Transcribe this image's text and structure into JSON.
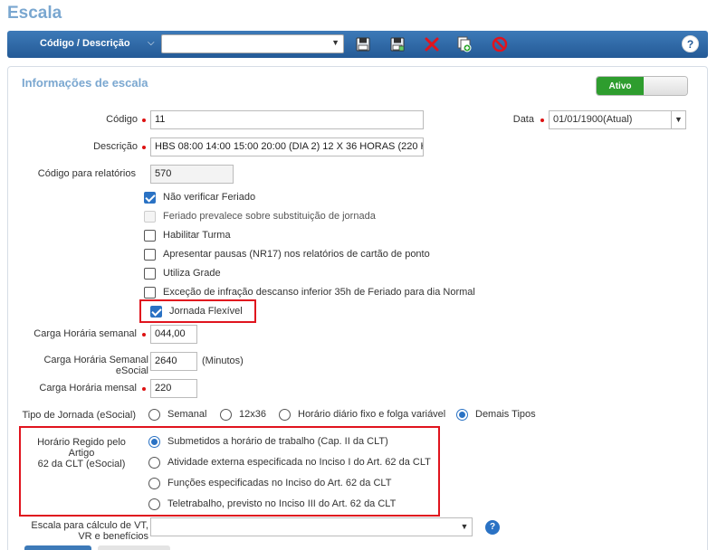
{
  "page": {
    "title": "Escala"
  },
  "toolbar": {
    "label": "Código / Descrição",
    "select_value": "",
    "icons": [
      "save-icon",
      "save-as-icon",
      "delete-icon",
      "copy-icon",
      "cancel-icon",
      "help-icon"
    ],
    "help": "?"
  },
  "panel": {
    "title": "Informações de escala",
    "status_toggle": "Ativo"
  },
  "fields": {
    "codigo_label": "Código",
    "codigo_value": "11",
    "data_label": "Data",
    "data_value": "01/01/1900(Atual)",
    "descricao_label": "Descrição",
    "descricao_value": "HBS 08:00 14:00 15:00 20:00 (DIA 2) 12 X 36 HORAS (220 H",
    "codigo_rel_label": "Código para relatórios",
    "codigo_rel_value": "570",
    "carga_semanal_label": "Carga Horária semanal",
    "carga_semanal_value": "044,00",
    "carga_esocial_label_1": "Carga Horária Semanal",
    "carga_esocial_label_2": "eSocial",
    "carga_esocial_value": "2640",
    "carga_esocial_unit": "(Minutos)",
    "carga_mensal_label": "Carga Horária mensal",
    "carga_mensal_value": "220",
    "tipo_jornada_label": "Tipo de Jornada (eSocial)",
    "horario_regido_label_1": "Horário Regido pelo Artigo",
    "horario_regido_label_2": "62 da CLT (eSocial)",
    "escala_vt_label_1": "Escala para cálculo de VT,",
    "escala_vt_label_2": "VR e benefícios",
    "escala_vt_value": "",
    "escala_help": "?"
  },
  "checkboxes": [
    {
      "label": "Não verificar Feriado",
      "checked": true,
      "disabled": false
    },
    {
      "label": "Feriado prevalece sobre substituição de jornada",
      "checked": false,
      "disabled": true
    },
    {
      "label": "Habilitar Turma",
      "checked": false,
      "disabled": false
    },
    {
      "label": "Apresentar pausas (NR17) nos relatórios de cartão de ponto",
      "checked": false,
      "disabled": false
    },
    {
      "label": "Utiliza Grade",
      "checked": false,
      "disabled": false
    },
    {
      "label": "Exceção de infração descanso inferior 35h de Feriado para dia Normal",
      "checked": false,
      "disabled": false
    },
    {
      "label": "Jornada Flexível",
      "checked": true,
      "disabled": false
    }
  ],
  "tipo_jornada": [
    {
      "label": "Semanal",
      "selected": false
    },
    {
      "label": "12x36",
      "selected": false
    },
    {
      "label": "Horário diário fixo e folga variável",
      "selected": false
    },
    {
      "label": "Demais Tipos",
      "selected": true
    }
  ],
  "horario_regido": [
    {
      "label": "Submetidos a horário de trabalho (Cap. II da CLT)",
      "selected": true
    },
    {
      "label": "Atividade externa especificada no Inciso I do Art. 62 da CLT",
      "selected": false
    },
    {
      "label": "Funções especificadas no Inciso do Art. 62 da CLT",
      "selected": false
    },
    {
      "label": "Teletrabalho, previsto no Inciso III do Art. 62 da CLT",
      "selected": false
    }
  ],
  "colors": {
    "accent": "#2a72c4",
    "toolbar": "#245a96",
    "title": "#7aa7d0",
    "highlight": "#e0141e",
    "active": "#2e9d2e"
  }
}
